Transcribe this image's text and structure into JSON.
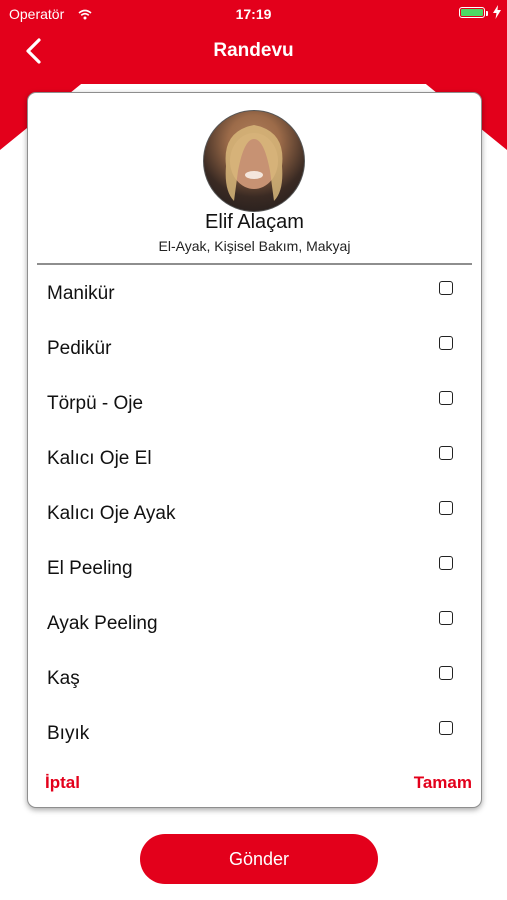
{
  "status_bar": {
    "carrier": "Operatör",
    "time": "17:19"
  },
  "icons": {
    "back": "chevron-left-icon",
    "wifi": "wifi-icon",
    "battery": "battery-icon",
    "charging": "lightning-icon",
    "checkbox": "checkbox-unchecked-icon"
  },
  "colors": {
    "brand_red": "#e3001b",
    "battery_green": "#4cd964"
  },
  "header": {
    "title": "Randevu"
  },
  "profile": {
    "name": "Elif Alaçam",
    "specialties": "El-Ayak, Kişisel Bakım, Makyaj"
  },
  "services": [
    {
      "label": "Manikür",
      "checked": false
    },
    {
      "label": "Pedikür",
      "checked": false
    },
    {
      "label": "Törpü - Oje",
      "checked": false
    },
    {
      "label": "Kalıcı Oje El",
      "checked": false
    },
    {
      "label": "Kalıcı Oje Ayak",
      "checked": false
    },
    {
      "label": "El Peeling",
      "checked": false
    },
    {
      "label": "Ayak Peeling",
      "checked": false
    },
    {
      "label": "Kaş",
      "checked": false
    },
    {
      "label": "Bıyık",
      "checked": false
    }
  ],
  "dialog_actions": {
    "cancel_label": "İptal",
    "ok_label": "Tamam"
  },
  "submit": {
    "label": "Gönder"
  }
}
